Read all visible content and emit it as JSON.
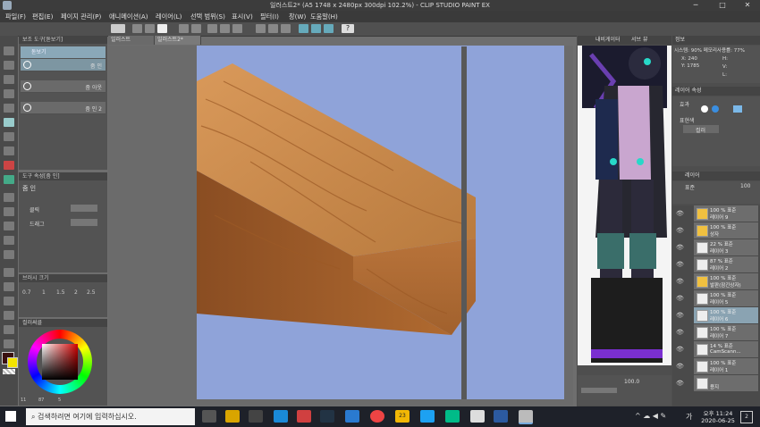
{
  "window": {
    "title": "일러스트2* (A5 1748 x 2480px 300dpi 102.2%)  - CLIP STUDIO PAINT EX",
    "app_icon": "clip-studio-icon",
    "minimize": "─",
    "maximize": "□",
    "close": "✕"
  },
  "menu": [
    "파일(F)",
    "편집(E)",
    "페이지 관리(P)",
    "애니메이션(A)",
    "레이어(L)",
    "선택 범위(S)",
    "표시(V)",
    "필터(I)",
    "창(W)",
    "도움말(H)"
  ],
  "tabs": {
    "tab1": "일러스트",
    "tab2": "일러스트2*"
  },
  "subtool": {
    "header": "보조 도구[돋보기]",
    "title": "돋보기",
    "items": [
      "줌 인",
      "줌 아웃",
      "줌 인 2"
    ]
  },
  "tool_property": {
    "header": "도구 속성[줌 인]",
    "title": "줌 인",
    "row1_label": "클릭",
    "row2_label": "드래그"
  },
  "brush_size": {
    "header": "브러시 크기",
    "values": [
      "0.7",
      "1",
      "1.5",
      "2",
      "2.5"
    ]
  },
  "color_wheel": {
    "header": "컬러써클",
    "hue_readout": "11",
    "sat_readout": "87",
    "val_readout": "5"
  },
  "navigator": {
    "tab1": "내비게이터",
    "tab2": "서브 뷰"
  },
  "info": {
    "tab": "정보",
    "line": "시스템: 90% 메모리사용률: 77%",
    "x": "X: 240",
    "y": "Y: 1785",
    "h": "H:",
    "v": "V:",
    "l": "L:"
  },
  "layer_property": {
    "header": "레이어 속성",
    "effect_label": "효과",
    "expression_label": "표현색",
    "expression_value": "컬러"
  },
  "layers_panel": {
    "header": "레이어",
    "blend": "표준",
    "opacity": "100"
  },
  "layers": [
    {
      "mode": "100 % 표준",
      "name": "레이어 9",
      "type": "folder"
    },
    {
      "mode": "100 % 표준",
      "name": "상자",
      "type": "folder"
    },
    {
      "mode": "22 % 표준",
      "name": "레이어 3",
      "type": "layer"
    },
    {
      "mode": "87 % 표준",
      "name": "레이어 2",
      "type": "layer"
    },
    {
      "mode": "100 % 표준",
      "name": "발판(잠긴상자)",
      "type": "folder"
    },
    {
      "mode": "100 % 표준",
      "name": "레이어 5",
      "type": "layer"
    },
    {
      "mode": "100 % 표준",
      "name": "레이어 6",
      "type": "layer"
    },
    {
      "mode": "100 % 표준",
      "name": "레이어 7",
      "type": "layer"
    },
    {
      "mode": "14 % 표준",
      "name": "CamScann...",
      "type": "layer"
    },
    {
      "mode": "100 % 표준",
      "name": "레이어 1",
      "type": "layer"
    },
    {
      "mode": "",
      "name": "용지",
      "type": "paper"
    }
  ],
  "subview": {
    "zoom": "100.0"
  },
  "taskbar": {
    "search_placeholder": "검색하려면 여기에 입력하십시오.",
    "badge": "23",
    "time": "오후 11:24",
    "date": "2020-06-25",
    "lang": "가",
    "notif": "2"
  },
  "colors": {
    "canvas_bg": "#8fa3d9",
    "wood_top": "#c98a4a",
    "wood_side": "#a5622d",
    "accent": "#0078d7"
  }
}
